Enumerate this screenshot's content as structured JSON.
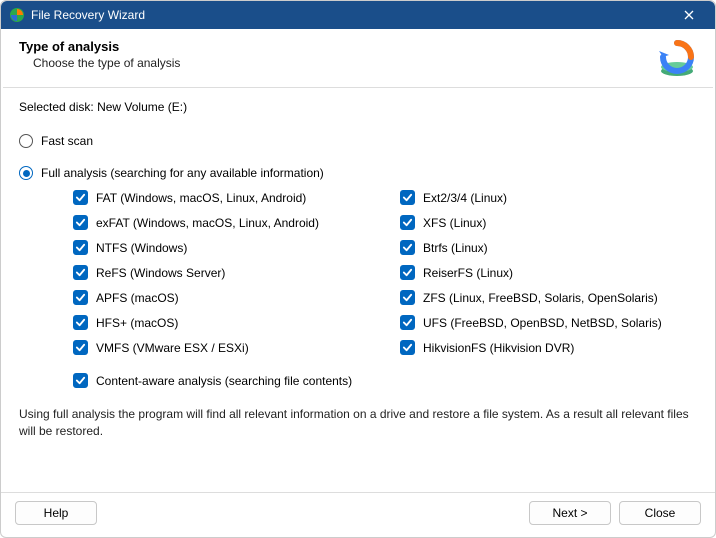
{
  "titlebar": {
    "title": "File Recovery Wizard"
  },
  "header": {
    "heading": "Type of analysis",
    "sub": "Choose the type of analysis"
  },
  "selected_disk_label": "Selected disk:",
  "selected_disk_value": "New Volume (E:)",
  "options": {
    "fast": {
      "label": "Fast scan",
      "selected": false
    },
    "full": {
      "label": "Full analysis (searching for any available information)",
      "selected": true
    }
  },
  "filesystems": {
    "col1": [
      {
        "label": "FAT (Windows, macOS, Linux, Android)",
        "checked": true
      },
      {
        "label": "exFAT (Windows, macOS, Linux, Android)",
        "checked": true
      },
      {
        "label": "NTFS (Windows)",
        "checked": true
      },
      {
        "label": "ReFS (Windows Server)",
        "checked": true
      },
      {
        "label": "APFS (macOS)",
        "checked": true
      },
      {
        "label": "HFS+ (macOS)",
        "checked": true
      },
      {
        "label": "VMFS (VMware ESX / ESXi)",
        "checked": true
      }
    ],
    "col2": [
      {
        "label": "Ext2/3/4 (Linux)",
        "checked": true
      },
      {
        "label": "XFS (Linux)",
        "checked": true
      },
      {
        "label": "Btrfs (Linux)",
        "checked": true
      },
      {
        "label": "ReiserFS (Linux)",
        "checked": true
      },
      {
        "label": "ZFS (Linux, FreeBSD, Solaris, OpenSolaris)",
        "checked": true
      },
      {
        "label": "UFS (FreeBSD, OpenBSD, NetBSD, Solaris)",
        "checked": true
      },
      {
        "label": "HikvisionFS (Hikvision DVR)",
        "checked": true
      }
    ]
  },
  "content_aware": {
    "label": "Content-aware analysis (searching file contents)",
    "checked": true
  },
  "description": "Using full analysis the program will find all relevant information on a drive and restore a file system. As a result all relevant files will be restored.",
  "footer": {
    "help": "Help",
    "next": "Next >",
    "close": "Close"
  }
}
